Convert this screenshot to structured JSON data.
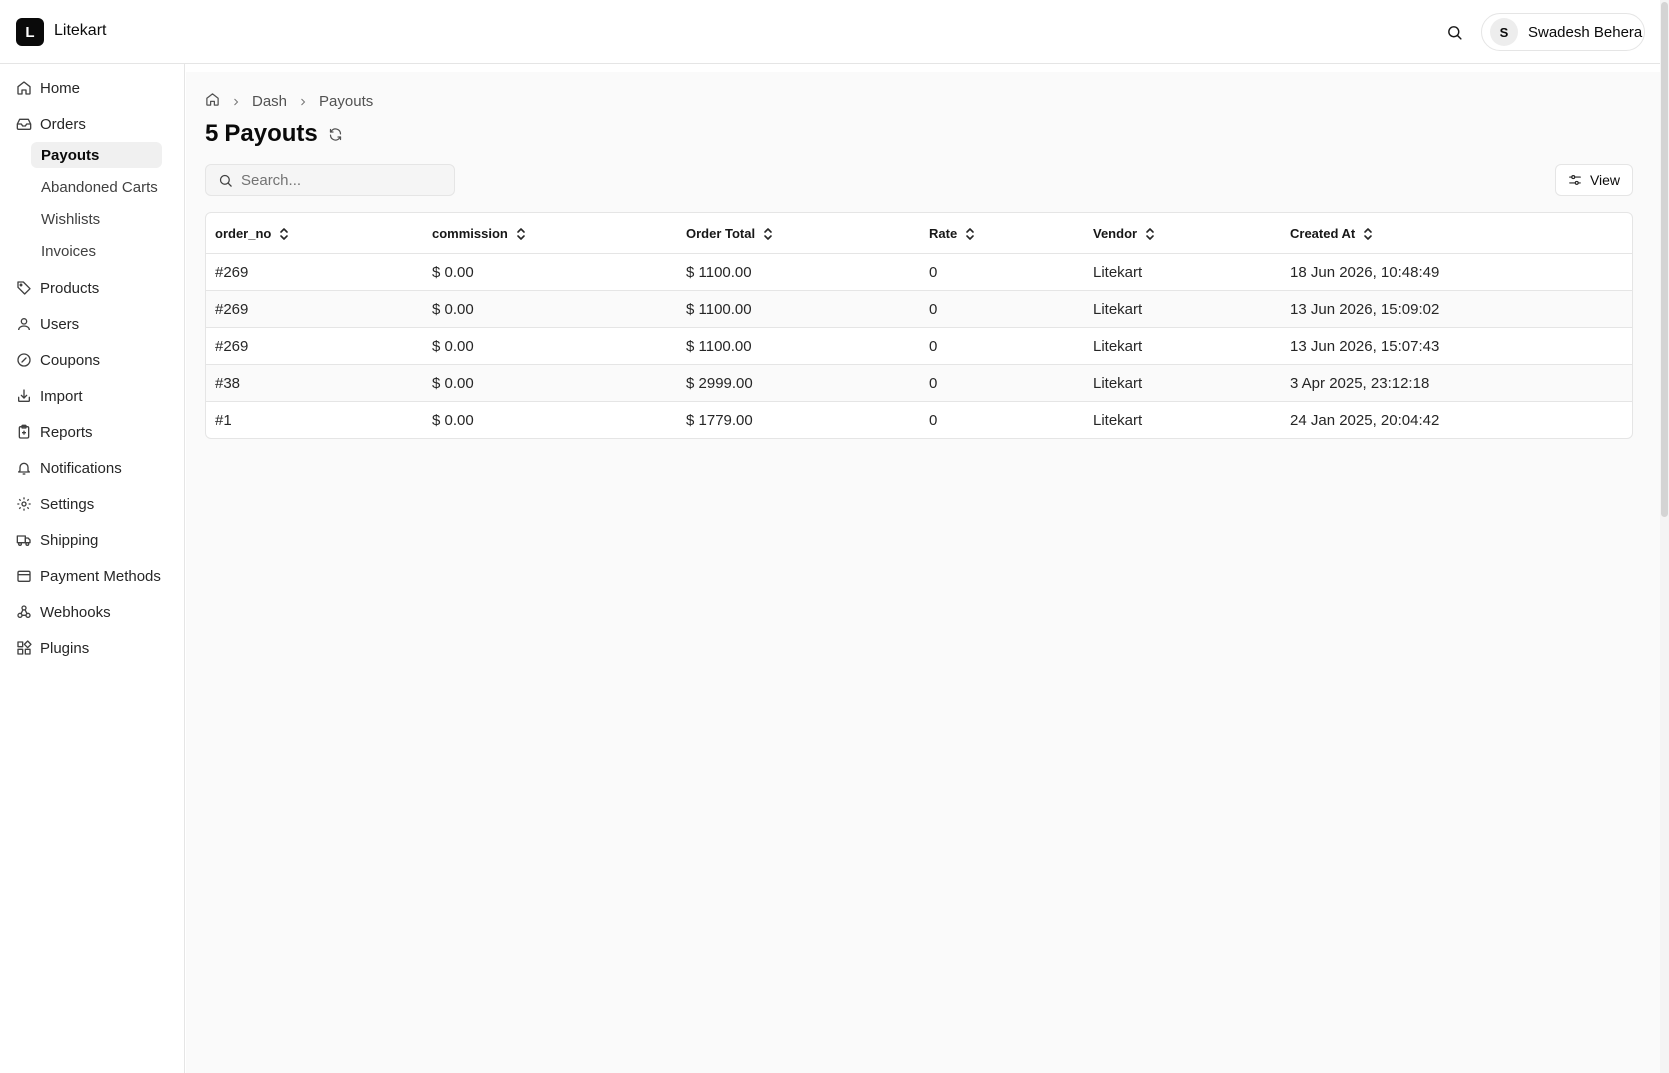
{
  "header": {
    "logo_letter": "L",
    "brand": "Litekart",
    "user_initial": "S",
    "user_name": "Swadesh Behera"
  },
  "sidebar": {
    "items": [
      {
        "label": "Home",
        "icon": "home-icon"
      },
      {
        "label": "Orders",
        "icon": "inbox-icon"
      },
      {
        "label": "Products",
        "icon": "tag-icon"
      },
      {
        "label": "Users",
        "icon": "user-icon"
      },
      {
        "label": "Coupons",
        "icon": "badge-percent-icon"
      },
      {
        "label": "Import",
        "icon": "import-icon"
      },
      {
        "label": "Reports",
        "icon": "clipboard-icon"
      },
      {
        "label": "Notifications",
        "icon": "bell-icon"
      },
      {
        "label": "Settings",
        "icon": "gear-icon"
      },
      {
        "label": "Shipping",
        "icon": "truck-icon"
      },
      {
        "label": "Payment Methods",
        "icon": "wallet-icon"
      },
      {
        "label": "Webhooks",
        "icon": "webhook-icon"
      },
      {
        "label": "Plugins",
        "icon": "blocks-icon"
      }
    ],
    "orders_sub": [
      {
        "label": "Payouts",
        "active": true
      },
      {
        "label": "Abandoned Carts"
      },
      {
        "label": "Wishlists"
      },
      {
        "label": "Invoices"
      }
    ]
  },
  "breadcrumb": {
    "items": [
      "Dash",
      "Payouts"
    ]
  },
  "page": {
    "count": "5",
    "title": "Payouts"
  },
  "search": {
    "placeholder": "Search..."
  },
  "toolbar": {
    "view_label": "View"
  },
  "table": {
    "columns": [
      "order_no",
      "commission",
      "Order Total",
      "Rate",
      "Vendor",
      "Created At"
    ],
    "rows": [
      [
        "#269",
        "$ 0.00",
        "$ 1100.00",
        "0",
        "Litekart",
        "18 Jun 2026, 10:48:49"
      ],
      [
        "#269",
        "$ 0.00",
        "$ 1100.00",
        "0",
        "Litekart",
        "13 Jun 2026, 15:09:02"
      ],
      [
        "#269",
        "$ 0.00",
        "$ 1100.00",
        "0",
        "Litekart",
        "13 Jun 2026, 15:07:43"
      ],
      [
        "#38",
        "$ 0.00",
        "$ 2999.00",
        "0",
        "Litekart",
        "3 Apr 2025, 23:12:18"
      ],
      [
        "#1",
        "$ 0.00",
        "$ 1779.00",
        "0",
        "Litekart",
        "24 Jan 2025, 20:04:42"
      ]
    ]
  }
}
